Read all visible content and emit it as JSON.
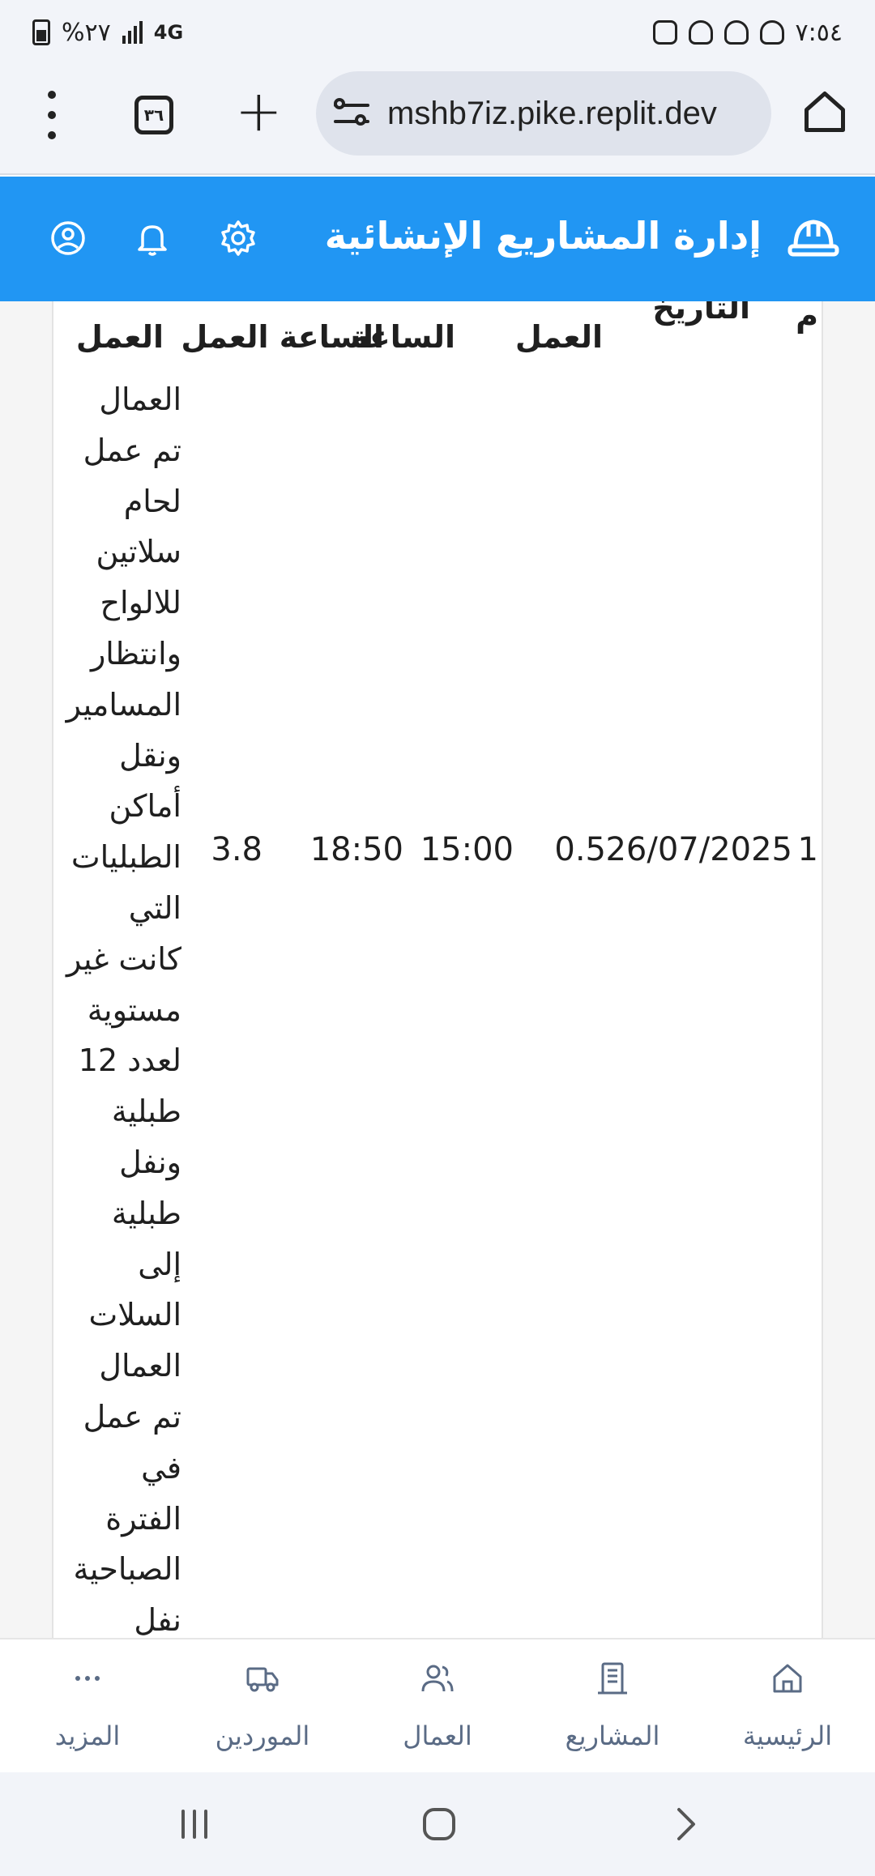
{
  "status_bar": {
    "time": "٧:٥٤",
    "battery": "%٢٧",
    "network": "4G"
  },
  "browser": {
    "url": "mshb7iz.pike.replit.dev",
    "tab_count": "٣٦"
  },
  "app": {
    "title": "إدارة المشاريع الإنشائية",
    "accent_color": "#2196f3"
  },
  "table": {
    "headers": {
      "index": "م",
      "date": "التاريخ",
      "work_days": "العمل",
      "start_time": "الساعة",
      "end_time": "الساعة العمل",
      "description": "العمل"
    },
    "row": {
      "index": "1",
      "date": "26/07/2025",
      "work_days": "0.5",
      "start_time": "15:00",
      "end_time": "18:50",
      "hours": "3.8",
      "description_lines": [
        "العمال",
        "تم عمل",
        "لحام",
        "سلاتين",
        "للالواح",
        "وانتظار",
        "المسامير",
        "ونقل",
        "أماكن",
        "الطبليات",
        "التي",
        "كانت غير",
        "مستوية",
        "لعدد 12",
        "طبلية",
        "ونفل",
        "طبلية",
        "إلى",
        "السلات",
        "العمال",
        "تم عمل",
        "في",
        "الفترة",
        "الصباحية",
        "نفل"
      ]
    }
  },
  "bottom_nav": {
    "items": [
      {
        "label": "الرئيسية",
        "icon": "home-icon"
      },
      {
        "label": "المشاريع",
        "icon": "building-icon"
      },
      {
        "label": "العمال",
        "icon": "users-icon"
      },
      {
        "label": "الموردين",
        "icon": "truck-icon"
      },
      {
        "label": "المزيد",
        "icon": "more-icon"
      }
    ]
  }
}
